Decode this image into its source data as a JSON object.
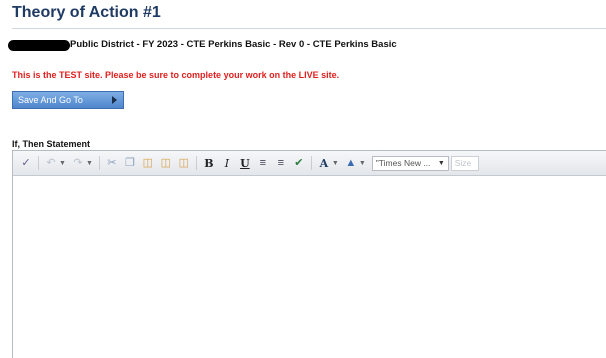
{
  "header": {
    "title": "Theory of Action #1",
    "district_line": "Public District - FY 2023 - CTE Perkins Basic - Rev 0 - CTE Perkins Basic"
  },
  "notice": {
    "text": "This is the TEST site. Please be sure to complete your work on the LIVE site.",
    "color": "#e02020"
  },
  "actions": {
    "save_and_go_label": "Save And Go To"
  },
  "field": {
    "label": "If, Then Statement"
  },
  "editor": {
    "toolbar_icons": [
      "spellcheck-icon",
      "undo-icon",
      "redo-icon",
      "cut-icon",
      "copy-icon",
      "paste-icon",
      "paste-text-icon",
      "paste-word-icon",
      "bold-icon",
      "italic-icon",
      "underline-icon",
      "ordered-list-icon",
      "unordered-list-icon",
      "spell-check-icon",
      "font-color-icon",
      "highlight-color-icon"
    ],
    "font_name_value": "\"Times New ...",
    "font_size_value": "Size",
    "content": ""
  },
  "colors": {
    "title": "#1f3a63",
    "button": "#4f86cc"
  }
}
